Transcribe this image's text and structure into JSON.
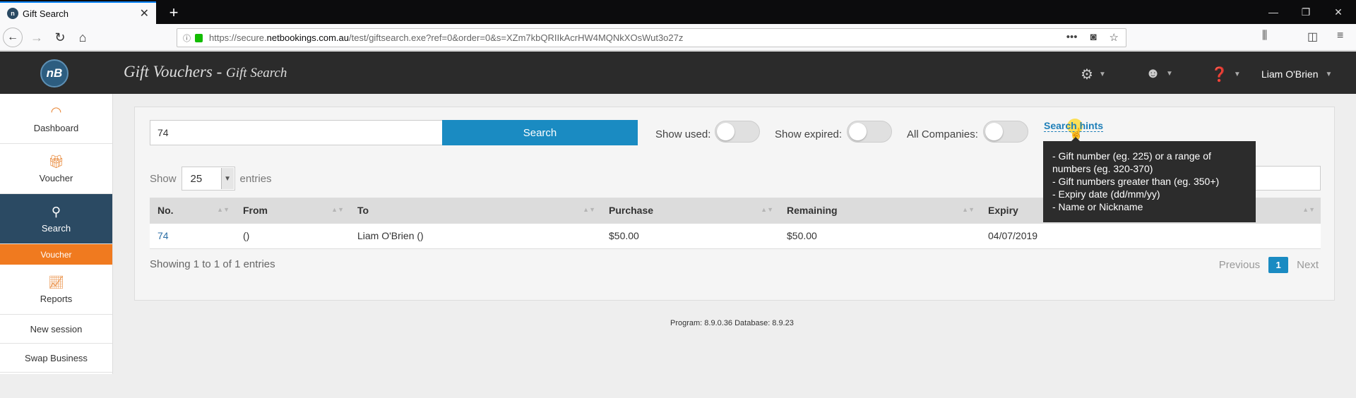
{
  "browser": {
    "tab_title": "Gift Search",
    "favicon_text": "n",
    "url_prefix": "https://secure.",
    "url_domain": "netbookings.com.au",
    "url_rest": "/test/giftsearch.exe?ref=0&order=0&s=XZm7kbQRIIkAcrHW4MQNkXOsWut3o27z"
  },
  "app": {
    "logo_text": "nB",
    "title_main": "Gift Vouchers - ",
    "title_sub": "Gift Search",
    "user_name": "Liam O'Brien"
  },
  "sidebar": {
    "items": [
      {
        "label": "Dashboard",
        "icon": "gauge-icon"
      },
      {
        "label": "Voucher",
        "icon": "gift-icon"
      },
      {
        "label": "Search",
        "icon": "search-icon"
      },
      {
        "label": "Reports",
        "icon": "chart-icon"
      }
    ],
    "active_sub": "Voucher",
    "links": [
      "New session",
      "Swap Business"
    ]
  },
  "search": {
    "value": "74",
    "button_label": "Search",
    "show_used_label": "Show used:",
    "show_expired_label": "Show expired:",
    "all_companies_label": "All Companies:",
    "hints_label": "Search hints"
  },
  "hints": [
    "- Gift number (eg. 225) or a range of",
    "numbers (eg. 320-370)",
    "- Gift numbers greater than (eg. 350+)",
    "- Expiry date (dd/mm/yy)",
    "- Name or Nickname"
  ],
  "table": {
    "show_label": "Show",
    "page_size": "25",
    "entries_label": "entries",
    "columns": [
      "No.",
      "From",
      "To",
      "Purchase",
      "Remaining",
      "Expiry",
      ""
    ],
    "rows": [
      {
        "no": "74",
        "from": "()",
        "to": "Liam O'Brien ()",
        "purchase": "$50.00",
        "remaining": "$50.00",
        "expiry": "04/07/2019",
        "extra": ""
      }
    ],
    "info": "Showing 1 to 1 of 1 entries",
    "prev": "Previous",
    "page": "1",
    "next": "Next"
  },
  "footer": "Program: 8.9.0.36 Database: 8.9.23"
}
